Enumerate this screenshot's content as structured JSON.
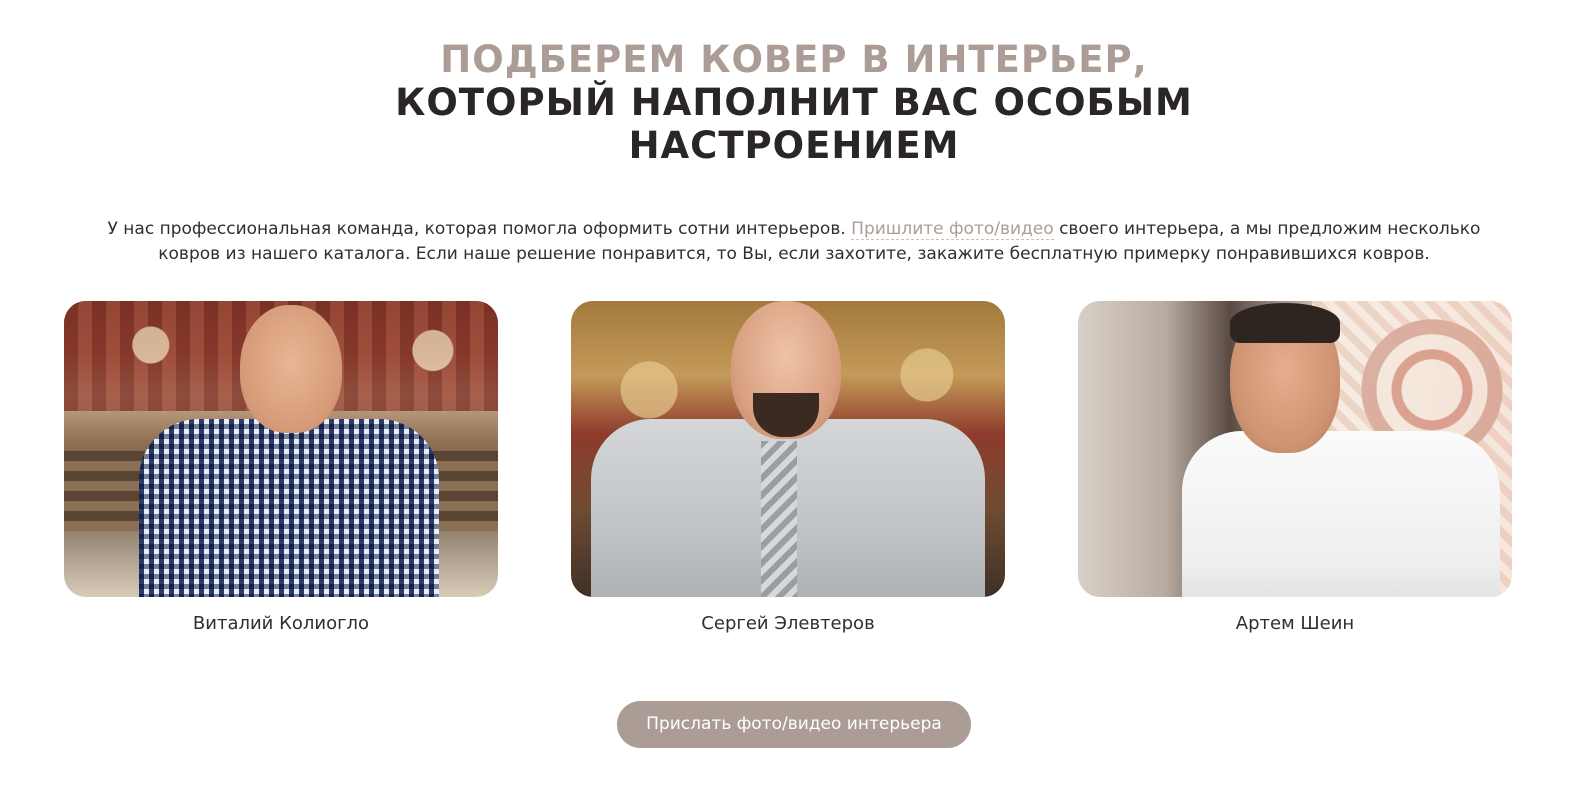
{
  "heading": {
    "line1": "ПОДБЕРЕМ КОВЕР В ИНТЕРЬЕР,",
    "line2": "КОТОРЫЙ НАПОЛНИТ ВАС ОСОБЫМ",
    "line3": "НАСТРОЕНИЕМ"
  },
  "intro": {
    "before_link": "У нас профессиональная команда, которая помогла оформить сотни интерьеров. ",
    "link_text": "Пришлите фото/видео",
    "after_link": " своего интерьера, а мы предложим несколько ковров из нашего каталога. Если наше решение понравится, то Вы, если захотите, закажите бесплатную примерку понравившихся ковров."
  },
  "team": [
    {
      "name": "Виталий Колиогло"
    },
    {
      "name": "Сергей Элевтеров"
    },
    {
      "name": "Артем Шеин"
    }
  ],
  "cta": {
    "label": "Прислать фото/видео интерьера"
  },
  "colors": {
    "accent": "#ab9c95",
    "heading_dark": "#2a2625",
    "text": "#2f2f2f"
  }
}
